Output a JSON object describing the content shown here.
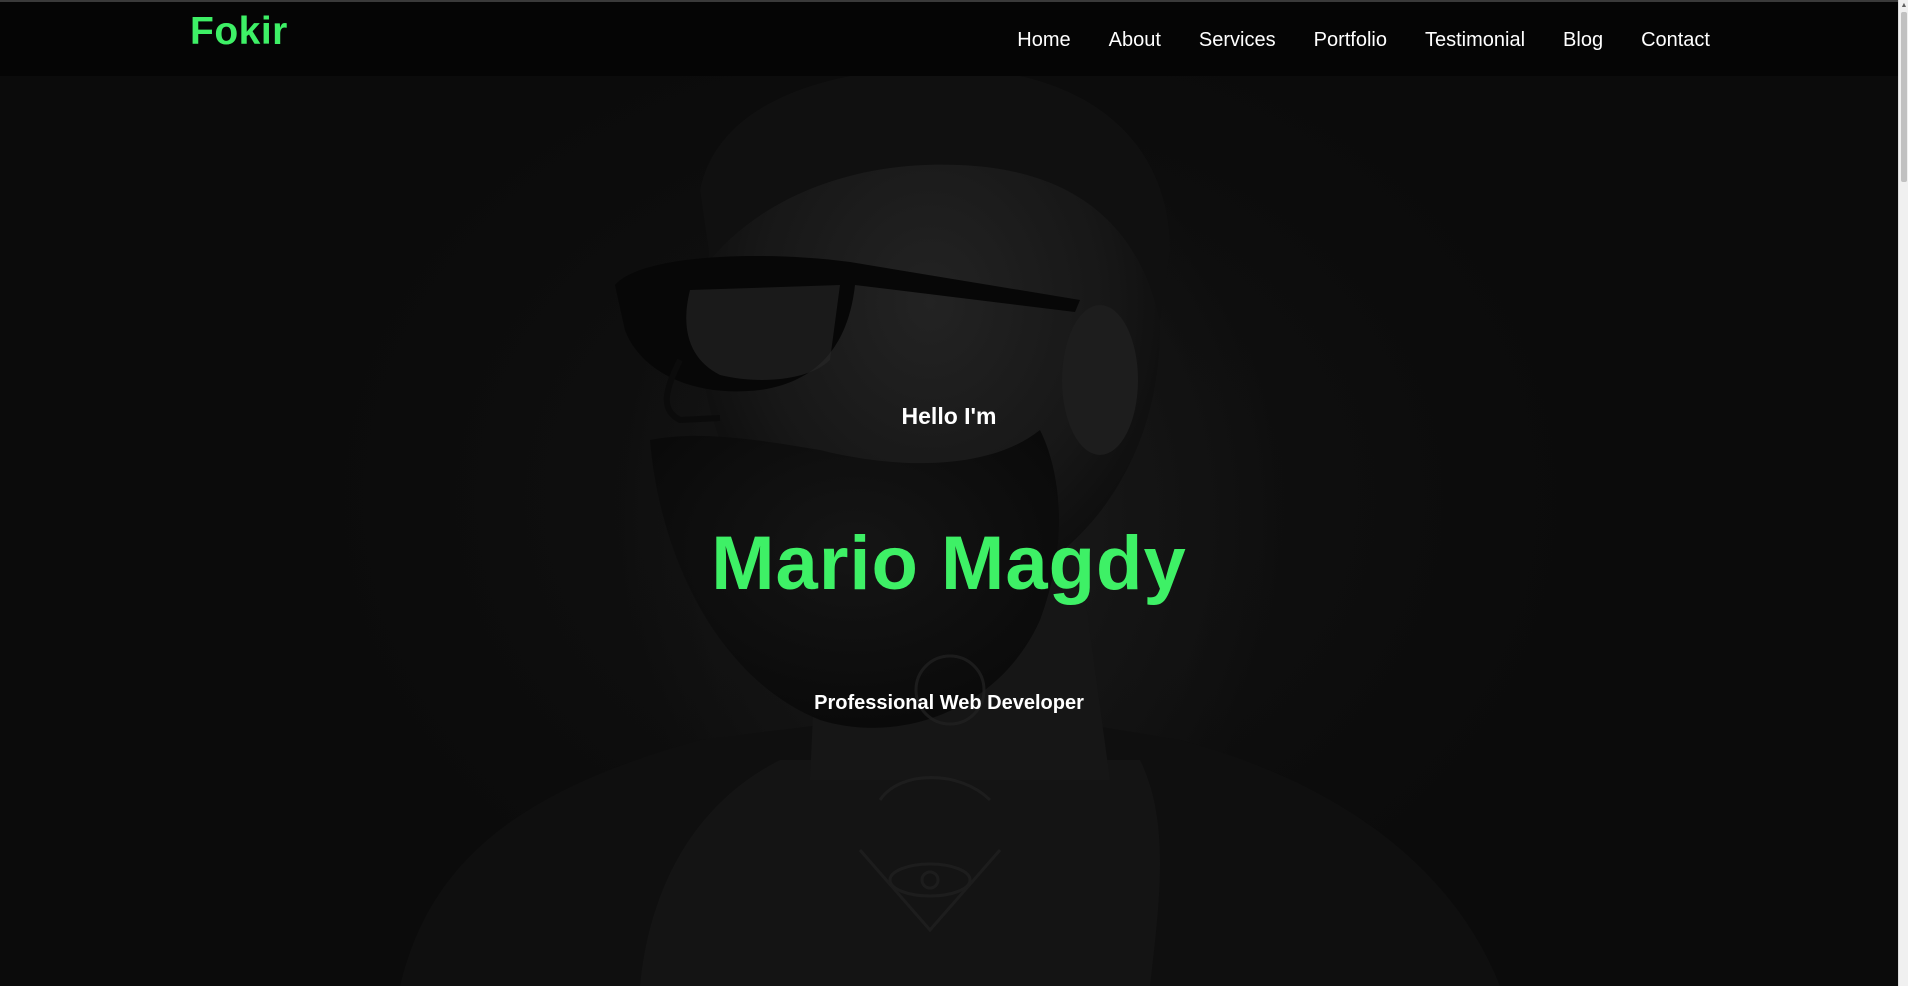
{
  "brand": {
    "logo_text": "Fokir",
    "accent_color": "#3ef066"
  },
  "nav": {
    "items": [
      {
        "label": "Home"
      },
      {
        "label": "About"
      },
      {
        "label": "Services"
      },
      {
        "label": "Portfolio"
      },
      {
        "label": "Testimonial"
      },
      {
        "label": "Blog"
      },
      {
        "label": "Contact"
      }
    ]
  },
  "hero": {
    "greeting": "Hello I'm",
    "name": "Mario Magdy",
    "role": "Professional Web Developer",
    "background_image": "portrait of bearded man with sunglasses and neck tattoos"
  },
  "scrollbar": {
    "up_icon": "chevron-up-icon"
  }
}
